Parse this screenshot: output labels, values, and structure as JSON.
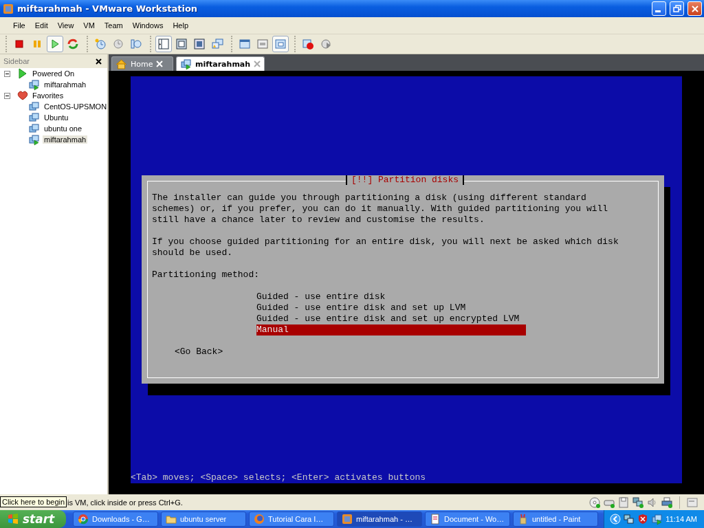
{
  "window": {
    "title": "miftarahmah - VMware Workstation"
  },
  "menu": [
    "File",
    "Edit",
    "View",
    "VM",
    "Team",
    "Windows",
    "Help"
  ],
  "toolbar": [
    [
      {
        "pressed": false
      },
      {
        "pressed": false
      },
      {
        "pressed": true
      },
      {
        "pressed": false
      }
    ],
    [
      {
        "pressed": false
      },
      {
        "pressed": false
      },
      {
        "pressed": false
      }
    ],
    [
      {
        "pressed": true
      },
      {
        "pressed": false
      },
      {
        "pressed": false
      },
      {
        "pressed": false
      }
    ],
    [
      {
        "pressed": false
      },
      {
        "pressed": false
      },
      {
        "pressed": true
      }
    ],
    [
      {
        "pressed": false
      },
      {
        "pressed": false
      }
    ]
  ],
  "sidebar": {
    "title": "Sidebar",
    "groups": [
      {
        "label": "Powered On",
        "expanded": true,
        "children": [
          {
            "label": "miftarahmah",
            "running": true,
            "selected": false
          }
        ]
      },
      {
        "label": "Favorites",
        "expanded": true,
        "children": [
          {
            "label": "CentOS-UPSMON",
            "running": false,
            "selected": false
          },
          {
            "label": "Ubuntu",
            "running": false,
            "selected": false
          },
          {
            "label": "ubuntu one",
            "running": false,
            "selected": false
          },
          {
            "label": "miftarahmah",
            "running": true,
            "selected": true
          }
        ]
      }
    ]
  },
  "tabs": [
    {
      "label": "Home",
      "selected": false
    },
    {
      "label": "miftarahmah",
      "selected": true
    }
  ],
  "console": {
    "dialog_title": "[!!] Partition disks",
    "paragraphs": [
      "The installer can guide you through partitioning a disk (using different standard\nschemes) or, if you prefer, you can do it manually. With guided partitioning you will\nstill have a chance later to review and customise the results.",
      "If you choose guided partitioning for an entire disk, you will next be asked which disk\nshould be used.",
      "Partitioning method:"
    ],
    "options": [
      {
        "label": "Guided - use entire disk",
        "selected": false
      },
      {
        "label": "Guided - use entire disk and set up LVM",
        "selected": false
      },
      {
        "label": "Guided - use entire disk and set up encrypted LVM",
        "selected": false
      },
      {
        "label": "Manual",
        "selected": true
      }
    ],
    "back_button": "<Go Back>",
    "hint": "<Tab> moves; <Space> selects; <Enter> activates buttons"
  },
  "status_bar": {
    "text": "is VM, click inside or press Ctrl+G.",
    "tooltip": "Click here to begin"
  },
  "taskbar": {
    "start": "start",
    "items": [
      {
        "label": "Downloads - G…",
        "selected": false
      },
      {
        "label": "ubuntu server",
        "selected": false
      },
      {
        "label": "Tutorial Cara I…",
        "selected": false
      },
      {
        "label": "miftarahmah - …",
        "selected": true
      },
      {
        "label": "Document - Wo…",
        "selected": false
      },
      {
        "label": "untitled - Paint",
        "selected": false
      }
    ],
    "clock": "11:14 AM"
  }
}
